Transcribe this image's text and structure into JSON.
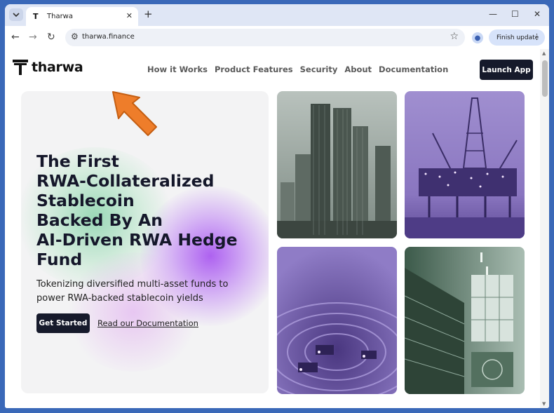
{
  "browser": {
    "tab_title": "Tharwa",
    "tab_favicon": "T",
    "url": "tharwa.finance",
    "finish_update_label": "Finish update"
  },
  "site": {
    "logo_text": "tharwa",
    "nav": [
      "How it Works",
      "Product Features",
      "Security",
      "About",
      "Documentation"
    ],
    "launch_app_label": "Launch App"
  },
  "hero": {
    "headline": "The First\nRWA-Collateralized\nStablecoin\nBacked By An\nAI-Driven RWA Hedge\nFund",
    "subheadline": "Tokenizing diversified multi-asset funds to power RWA-backed stablecoin yields",
    "cta_primary": "Get Started",
    "cta_secondary": "Read our Documentation"
  },
  "images": [
    {
      "icon": "skyscrapers-image",
      "tint": "#5c6b62"
    },
    {
      "icon": "oil-rig-image",
      "tint": "#6f58a8"
    },
    {
      "icon": "mine-image",
      "tint": "#6a4fa0"
    },
    {
      "icon": "server-room-image",
      "tint": "#4d6e5c"
    }
  ],
  "colors": {
    "accent_dark": "#161a2b",
    "browser_frame": "#3a68b8",
    "arrow": "#ee7d2a"
  }
}
